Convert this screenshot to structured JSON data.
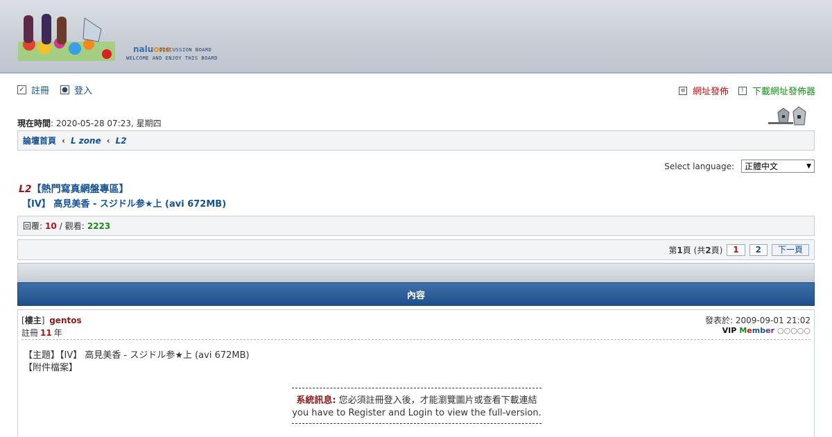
{
  "header": {
    "brand_prefix": "nalu",
    "brand_suffix": "one",
    "tagline_1": "DISCUSSION BOARD",
    "tagline_2": "WELCOME AND ENJOY THIS BOARD",
    "brand_colors": {
      "nalu": "#3c6fb0",
      "one": "#f08a1c"
    }
  },
  "nav": {
    "register": "註冊",
    "login": "登入",
    "url_publish": "網址發佈",
    "downloader": "下載網址發佈器"
  },
  "time": {
    "label": "現在時間",
    "value": ": 2020-05-28 07:23, 星期四"
  },
  "breadcrumb": {
    "home": "論壇首頁",
    "sep": "‹",
    "zone": "L zone",
    "forum": "L2"
  },
  "language": {
    "label": "Select language:",
    "selected": "正體中文"
  },
  "topic": {
    "forum_code": "L2",
    "forum_name": "【熱門寫真網盤專區】",
    "title": "【IV】 高見美香 - スジドル参★上 (avi 672MB)"
  },
  "stats": {
    "replies_label": "回覆:",
    "replies": "10",
    "slash": "/",
    "views_label": "觀看:",
    "views": "2223"
  },
  "pager": {
    "page_pre": "第",
    "page_num": "1",
    "page_mid": "頁 (共",
    "total": "2",
    "page_post": "頁)",
    "p1": "1",
    "p2": "2",
    "next": "下一頁"
  },
  "table": {
    "column_header": "內容"
  },
  "post": {
    "role_open": "[",
    "role": "樓主",
    "role_close": "]",
    "author": "gentos",
    "reg_label": "註冊",
    "reg_years": "11",
    "reg_unit": "年",
    "date": "發表於: 2009-09-01 21:02",
    "rank_vip": "VIP",
    "rank_m": "M",
    "rank_e": "e",
    "rank_mb": "mb",
    "rank_er": "er",
    "rank_stars": "○○○○○",
    "subject": "【主題】【IV】 高見美香 - スジドル参★上 (avi 672MB)",
    "attachment": "【附件檔案】",
    "notice_label": "系統訊息:",
    "notice_text": " 您必須註冊登入後，才能瀏覽圖片或查看下載連結",
    "notice_en": "you have to Register and Login to view the full-version."
  }
}
